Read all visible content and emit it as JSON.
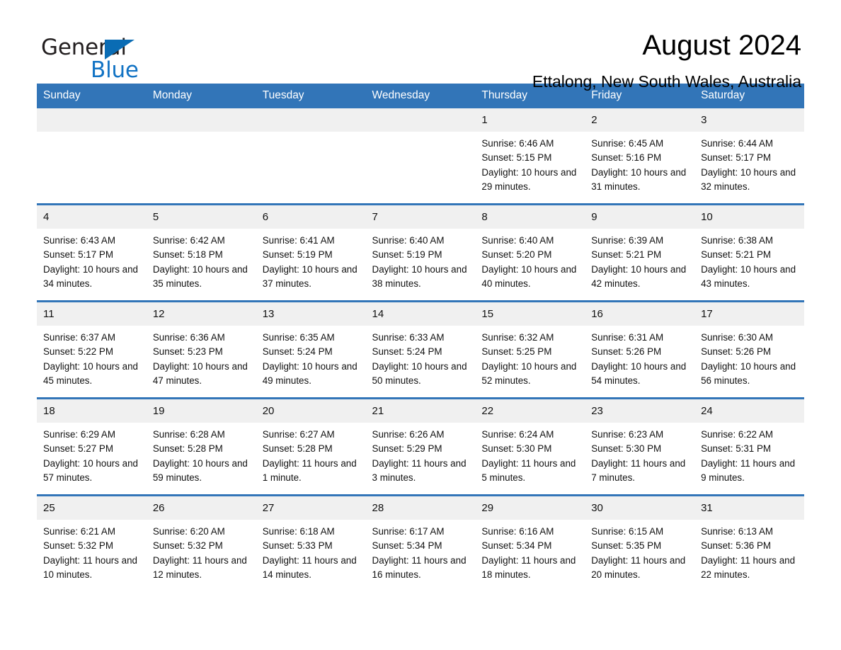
{
  "logo": {
    "word1": "General",
    "word2": "Blue",
    "triangle_color": "#0a6cb4",
    "blue_color": "#1273c4"
  },
  "header": {
    "title": "August 2024",
    "location": "Ettalong, New South Wales, Australia"
  },
  "theme": {
    "header_bg": "#3275b8",
    "daynum_bg": "#f0f0f0",
    "row_border": "#3275b8"
  },
  "calendar": {
    "weekday_headers": [
      "Sunday",
      "Monday",
      "Tuesday",
      "Wednesday",
      "Thursday",
      "Friday",
      "Saturday"
    ],
    "weeks": [
      [
        {
          "day": "",
          "empty": true
        },
        {
          "day": "",
          "empty": true
        },
        {
          "day": "",
          "empty": true
        },
        {
          "day": "",
          "empty": true
        },
        {
          "day": "1",
          "sunrise": "Sunrise: 6:46 AM",
          "sunset": "Sunset: 5:15 PM",
          "daylight": "Daylight: 10 hours and 29 minutes."
        },
        {
          "day": "2",
          "sunrise": "Sunrise: 6:45 AM",
          "sunset": "Sunset: 5:16 PM",
          "daylight": "Daylight: 10 hours and 31 minutes."
        },
        {
          "day": "3",
          "sunrise": "Sunrise: 6:44 AM",
          "sunset": "Sunset: 5:17 PM",
          "daylight": "Daylight: 10 hours and 32 minutes."
        }
      ],
      [
        {
          "day": "4",
          "sunrise": "Sunrise: 6:43 AM",
          "sunset": "Sunset: 5:17 PM",
          "daylight": "Daylight: 10 hours and 34 minutes."
        },
        {
          "day": "5",
          "sunrise": "Sunrise: 6:42 AM",
          "sunset": "Sunset: 5:18 PM",
          "daylight": "Daylight: 10 hours and 35 minutes."
        },
        {
          "day": "6",
          "sunrise": "Sunrise: 6:41 AM",
          "sunset": "Sunset: 5:19 PM",
          "daylight": "Daylight: 10 hours and 37 minutes."
        },
        {
          "day": "7",
          "sunrise": "Sunrise: 6:40 AM",
          "sunset": "Sunset: 5:19 PM",
          "daylight": "Daylight: 10 hours and 38 minutes."
        },
        {
          "day": "8",
          "sunrise": "Sunrise: 6:40 AM",
          "sunset": "Sunset: 5:20 PM",
          "daylight": "Daylight: 10 hours and 40 minutes."
        },
        {
          "day": "9",
          "sunrise": "Sunrise: 6:39 AM",
          "sunset": "Sunset: 5:21 PM",
          "daylight": "Daylight: 10 hours and 42 minutes."
        },
        {
          "day": "10",
          "sunrise": "Sunrise: 6:38 AM",
          "sunset": "Sunset: 5:21 PM",
          "daylight": "Daylight: 10 hours and 43 minutes."
        }
      ],
      [
        {
          "day": "11",
          "sunrise": "Sunrise: 6:37 AM",
          "sunset": "Sunset: 5:22 PM",
          "daylight": "Daylight: 10 hours and 45 minutes."
        },
        {
          "day": "12",
          "sunrise": "Sunrise: 6:36 AM",
          "sunset": "Sunset: 5:23 PM",
          "daylight": "Daylight: 10 hours and 47 minutes."
        },
        {
          "day": "13",
          "sunrise": "Sunrise: 6:35 AM",
          "sunset": "Sunset: 5:24 PM",
          "daylight": "Daylight: 10 hours and 49 minutes."
        },
        {
          "day": "14",
          "sunrise": "Sunrise: 6:33 AM",
          "sunset": "Sunset: 5:24 PM",
          "daylight": "Daylight: 10 hours and 50 minutes."
        },
        {
          "day": "15",
          "sunrise": "Sunrise: 6:32 AM",
          "sunset": "Sunset: 5:25 PM",
          "daylight": "Daylight: 10 hours and 52 minutes."
        },
        {
          "day": "16",
          "sunrise": "Sunrise: 6:31 AM",
          "sunset": "Sunset: 5:26 PM",
          "daylight": "Daylight: 10 hours and 54 minutes."
        },
        {
          "day": "17",
          "sunrise": "Sunrise: 6:30 AM",
          "sunset": "Sunset: 5:26 PM",
          "daylight": "Daylight: 10 hours and 56 minutes."
        }
      ],
      [
        {
          "day": "18",
          "sunrise": "Sunrise: 6:29 AM",
          "sunset": "Sunset: 5:27 PM",
          "daylight": "Daylight: 10 hours and 57 minutes."
        },
        {
          "day": "19",
          "sunrise": "Sunrise: 6:28 AM",
          "sunset": "Sunset: 5:28 PM",
          "daylight": "Daylight: 10 hours and 59 minutes."
        },
        {
          "day": "20",
          "sunrise": "Sunrise: 6:27 AM",
          "sunset": "Sunset: 5:28 PM",
          "daylight": "Daylight: 11 hours and 1 minute."
        },
        {
          "day": "21",
          "sunrise": "Sunrise: 6:26 AM",
          "sunset": "Sunset: 5:29 PM",
          "daylight": "Daylight: 11 hours and 3 minutes."
        },
        {
          "day": "22",
          "sunrise": "Sunrise: 6:24 AM",
          "sunset": "Sunset: 5:30 PM",
          "daylight": "Daylight: 11 hours and 5 minutes."
        },
        {
          "day": "23",
          "sunrise": "Sunrise: 6:23 AM",
          "sunset": "Sunset: 5:30 PM",
          "daylight": "Daylight: 11 hours and 7 minutes."
        },
        {
          "day": "24",
          "sunrise": "Sunrise: 6:22 AM",
          "sunset": "Sunset: 5:31 PM",
          "daylight": "Daylight: 11 hours and 9 minutes."
        }
      ],
      [
        {
          "day": "25",
          "sunrise": "Sunrise: 6:21 AM",
          "sunset": "Sunset: 5:32 PM",
          "daylight": "Daylight: 11 hours and 10 minutes."
        },
        {
          "day": "26",
          "sunrise": "Sunrise: 6:20 AM",
          "sunset": "Sunset: 5:32 PM",
          "daylight": "Daylight: 11 hours and 12 minutes."
        },
        {
          "day": "27",
          "sunrise": "Sunrise: 6:18 AM",
          "sunset": "Sunset: 5:33 PM",
          "daylight": "Daylight: 11 hours and 14 minutes."
        },
        {
          "day": "28",
          "sunrise": "Sunrise: 6:17 AM",
          "sunset": "Sunset: 5:34 PM",
          "daylight": "Daylight: 11 hours and 16 minutes."
        },
        {
          "day": "29",
          "sunrise": "Sunrise: 6:16 AM",
          "sunset": "Sunset: 5:34 PM",
          "daylight": "Daylight: 11 hours and 18 minutes."
        },
        {
          "day": "30",
          "sunrise": "Sunrise: 6:15 AM",
          "sunset": "Sunset: 5:35 PM",
          "daylight": "Daylight: 11 hours and 20 minutes."
        },
        {
          "day": "31",
          "sunrise": "Sunrise: 6:13 AM",
          "sunset": "Sunset: 5:36 PM",
          "daylight": "Daylight: 11 hours and 22 minutes."
        }
      ]
    ]
  }
}
